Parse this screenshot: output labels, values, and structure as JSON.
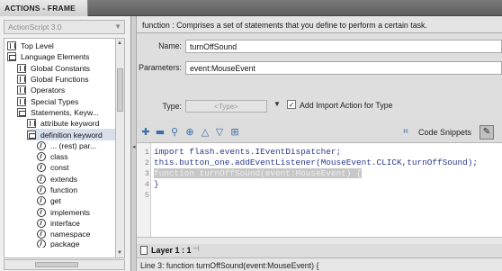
{
  "window": {
    "title": "ACTIONS - FRAME"
  },
  "left_panel": {
    "language_select": "ActionScript 3.0",
    "tree": [
      {
        "label": "Top Level",
        "icon": "book-icon"
      },
      {
        "label": "Language Elements",
        "icon": "book-open-icon"
      },
      {
        "label": "Global Constants",
        "icon": "book-icon"
      },
      {
        "label": "Global Functions",
        "icon": "book-icon"
      },
      {
        "label": "Operators",
        "icon": "book-icon"
      },
      {
        "label": "Special Types",
        "icon": "book-icon"
      },
      {
        "label": "Statements, Keyw...",
        "icon": "book-open-icon"
      },
      {
        "label": "attribute keyword",
        "icon": "book-icon"
      },
      {
        "label": "definition keyword",
        "icon": "book-open-icon"
      },
      {
        "label": "... (rest) par...",
        "icon": "item-icon"
      },
      {
        "label": "class",
        "icon": "item-icon"
      },
      {
        "label": "const",
        "icon": "item-icon"
      },
      {
        "label": "extends",
        "icon": "item-icon"
      },
      {
        "label": "function",
        "icon": "item-icon"
      },
      {
        "label": "get",
        "icon": "item-icon"
      },
      {
        "label": "implements",
        "icon": "item-icon"
      },
      {
        "label": "interface",
        "icon": "item-icon"
      },
      {
        "label": "namespace",
        "icon": "item-icon"
      },
      {
        "label": "package",
        "icon": "item-icon"
      }
    ]
  },
  "description": "function : Comprises a set of statements that you define to perform a certain task.",
  "form": {
    "name_label": "Name:",
    "name_value": "turnOffSound",
    "params_label": "Parameters:",
    "params_value": "event:MouseEvent",
    "type_label": "Type:",
    "type_value": "<Type>",
    "import_checkbox_checked": true,
    "import_label": "Add Import Action for Type"
  },
  "toolbar": {
    "icons": [
      "add-icon",
      "remove-icon",
      "find-icon",
      "target-icon",
      "move-up-icon",
      "move-down-icon",
      "insert-icon"
    ],
    "snippets_label": "Code Snippets",
    "wrench_icon": "wrench-icon"
  },
  "editor": {
    "lines": [
      {
        "number": "1",
        "text": "import flash.events.IEventDispatcher;",
        "highlighted": false
      },
      {
        "number": "2",
        "text": "this.button_one.addEventListener(MouseEvent.CLICK,turnOffSound);",
        "highlighted": false
      },
      {
        "number": "3",
        "text": "function turnOffSound(event:MouseEvent) {",
        "highlighted": true
      },
      {
        "number": "4",
        "text": "}",
        "highlighted": false
      },
      {
        "number": "5",
        "text": "",
        "highlighted": false
      }
    ]
  },
  "layer_tab": {
    "label": "Layer 1 : 1"
  },
  "status": "Line 3: function turnOffSound(event:MouseEvent) {",
  "colors": {
    "code_text": "#2d3a8c",
    "highlight_bg": "#c7c7c7",
    "selection_bg": "#d7dfec"
  }
}
